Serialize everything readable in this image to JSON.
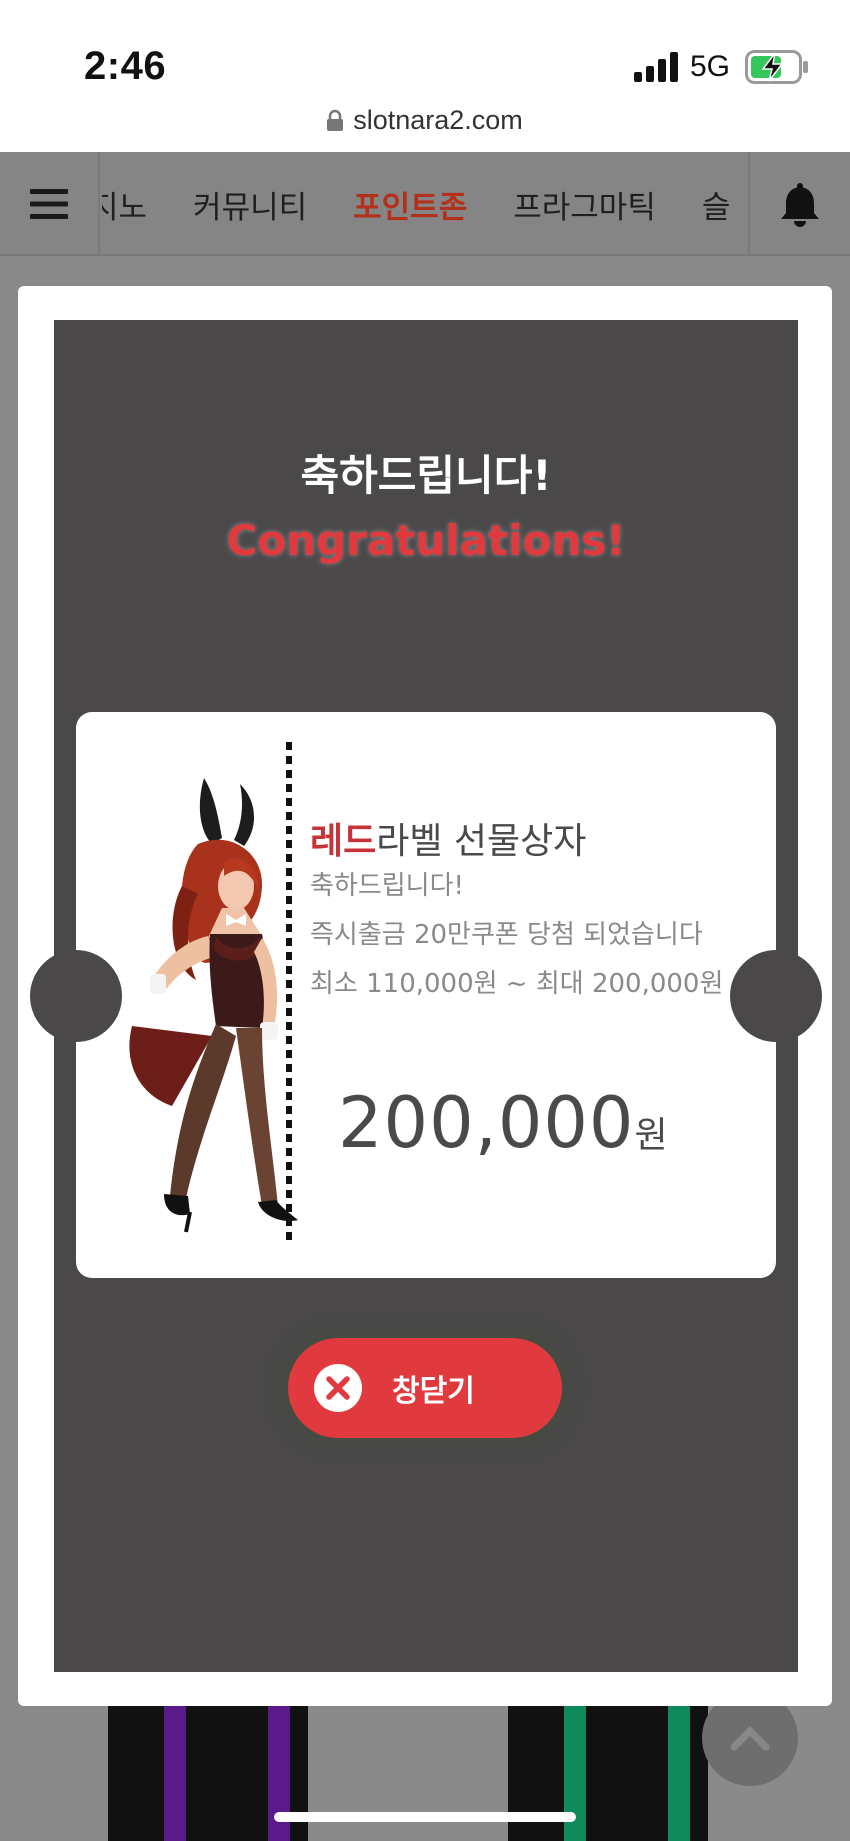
{
  "status_bar": {
    "time": "2:46",
    "network": "5G",
    "url": "slotnara2.com"
  },
  "nav": {
    "items": [
      {
        "label": "지노",
        "active": false
      },
      {
        "label": "커뮤니티",
        "active": false
      },
      {
        "label": "포인트존",
        "active": true
      },
      {
        "label": "프라그마틱",
        "active": false
      },
      {
        "label": "슬",
        "active": false
      }
    ],
    "icons": {
      "menu": "hamburger-icon",
      "alerts": "bell-icon"
    },
    "active_color": "#b3301a"
  },
  "modal": {
    "title_ko": "축하드립니다!",
    "title_en": "Congratulations!",
    "ticket": {
      "prize_name_accent": "레드",
      "prize_name_rest": "라벨 선물상자",
      "message_line1": "축하드립니다!",
      "message_line2": "즉시출금 20만쿠폰 당첨 되었습니다",
      "range": "최소 110,000원 ~ 최대 200,000원",
      "amount": "200,000",
      "amount_unit": "원"
    },
    "close_label": "창닫기",
    "accent_color": "#e03a3e"
  }
}
